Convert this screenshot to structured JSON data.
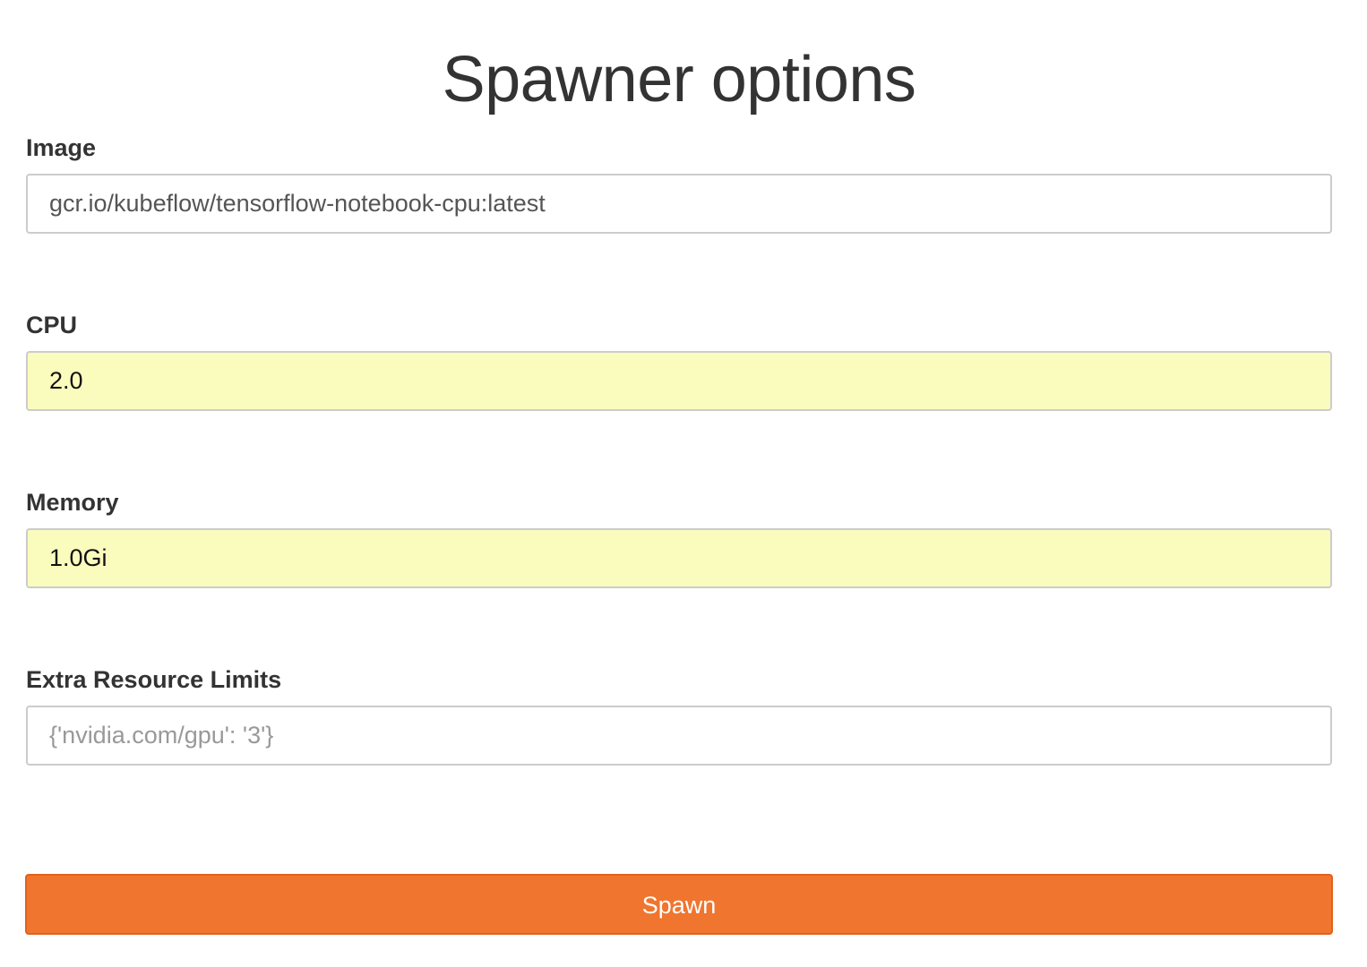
{
  "page": {
    "title": "Spawner options"
  },
  "form": {
    "image": {
      "label": "Image",
      "value": "gcr.io/kubeflow/tensorflow-notebook-cpu:latest"
    },
    "cpu": {
      "label": "CPU",
      "value": "2.0"
    },
    "memory": {
      "label": "Memory",
      "value": "1.0Gi"
    },
    "extra_resource_limits": {
      "label": "Extra Resource Limits",
      "value": "",
      "placeholder": "{'nvidia.com/gpu': '3'}"
    },
    "submit_label": "Spawn"
  },
  "colors": {
    "autofill_background": "#fafcbd",
    "button_background": "#f0752f",
    "button_border": "#e2621c",
    "text": "#333333"
  }
}
